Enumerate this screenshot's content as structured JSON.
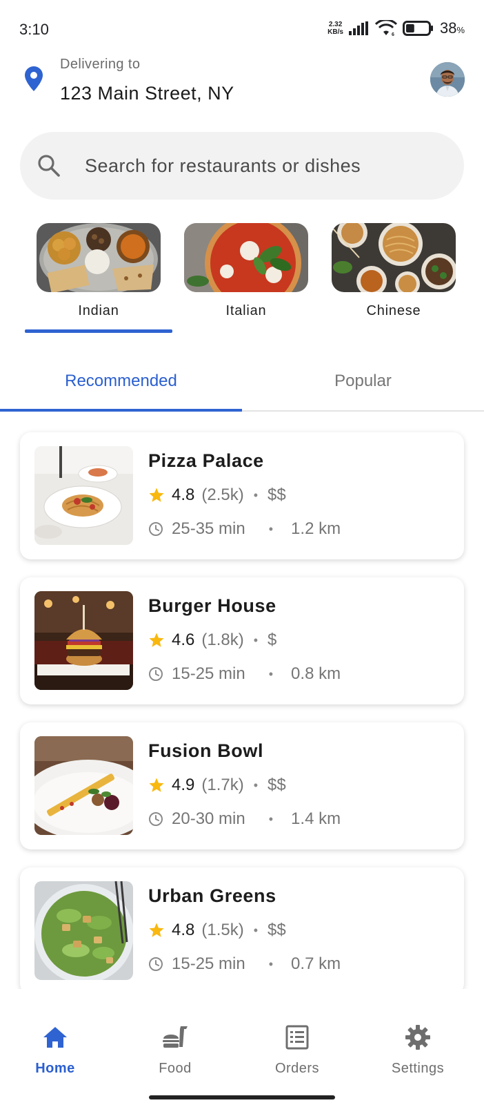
{
  "status_bar": {
    "time": "3:10",
    "net_speed_value": "2.32",
    "net_speed_unit": "KB/s",
    "battery_percent": "38",
    "battery_symbol": "%",
    "battery_level": 0.38
  },
  "header": {
    "delivering_label": "Delivering to",
    "address": "123 Main Street, NY"
  },
  "search": {
    "placeholder": "Search for restaurants or dishes"
  },
  "categories": [
    {
      "label": "Indian",
      "selected": true
    },
    {
      "label": "Italian",
      "selected": false
    },
    {
      "label": "Chinese",
      "selected": false
    }
  ],
  "tabs": [
    {
      "label": "Recommended",
      "active": true
    },
    {
      "label": "Popular",
      "active": false
    }
  ],
  "restaurants": [
    {
      "name": "Pizza Palace",
      "rating": "4.8",
      "reviews": "(2.5k)",
      "price": "$$",
      "time": "25-35 min",
      "distance": "1.2 km"
    },
    {
      "name": "Burger House",
      "rating": "4.6",
      "reviews": "(1.8k)",
      "price": "$",
      "time": "15-25 min",
      "distance": "0.8 km"
    },
    {
      "name": "Fusion Bowl",
      "rating": "4.9",
      "reviews": "(1.7k)",
      "price": "$$",
      "time": "20-30 min",
      "distance": "1.4 km"
    },
    {
      "name": "Urban Greens",
      "rating": "4.8",
      "reviews": "(1.5k)",
      "price": "$$",
      "time": "15-25 min",
      "distance": "0.7 km"
    }
  ],
  "separators": {
    "dot": "•"
  },
  "bottom_nav": [
    {
      "label": "Home",
      "icon": "home-icon",
      "active": true
    },
    {
      "label": "Food",
      "icon": "food-icon",
      "active": false
    },
    {
      "label": "Orders",
      "icon": "orders-icon",
      "active": false
    },
    {
      "label": "Settings",
      "icon": "settings-icon",
      "active": false
    }
  ],
  "colors": {
    "accent": "#2f63d1",
    "star": "#f9b80f",
    "muted_text": "#757575",
    "search_bg": "#f2f2f2"
  }
}
